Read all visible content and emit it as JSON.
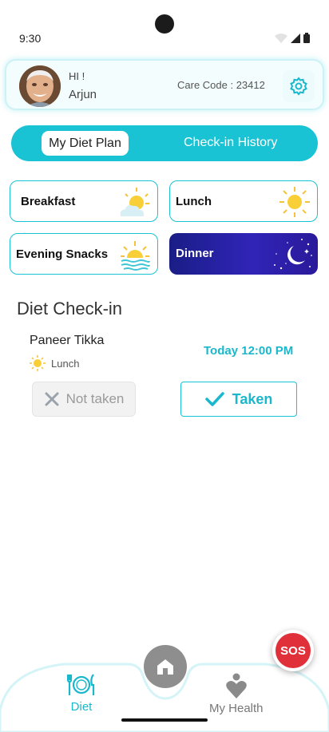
{
  "status": {
    "time": "9:30"
  },
  "profile": {
    "greeting": "HI !",
    "name": "Arjun",
    "care_code": "Care Code : 23412",
    "avatar_icon": "elderly-man-avatar",
    "settings_icon": "gear-icon"
  },
  "tabs": [
    {
      "label": "My Diet Plan",
      "active": true
    },
    {
      "label": "Check-in History",
      "active": false
    }
  ],
  "meals": {
    "breakfast": {
      "label": "Breakfast",
      "icon": "sun-cloud-icon"
    },
    "lunch": {
      "label": "Lunch",
      "icon": "sun-icon"
    },
    "snacks": {
      "label": "Evening Snacks",
      "icon": "sunset-icon"
    },
    "dinner": {
      "label": "Dinner",
      "icon": "moon-stars-icon"
    }
  },
  "checkin": {
    "title": "Diet Check-in",
    "dish": "Paneer Tikka",
    "meal_type": "Lunch",
    "time": "Today 12:00 PM",
    "not_taken_label": "Not taken",
    "taken_label": "Taken"
  },
  "nav": {
    "diet_label": "Diet",
    "health_label": "My Health",
    "sos_label": "SOS"
  },
  "colors": {
    "accent": "#1ac3d4",
    "sos": "#e0303a",
    "dinner_bg": "#2a22a8"
  }
}
